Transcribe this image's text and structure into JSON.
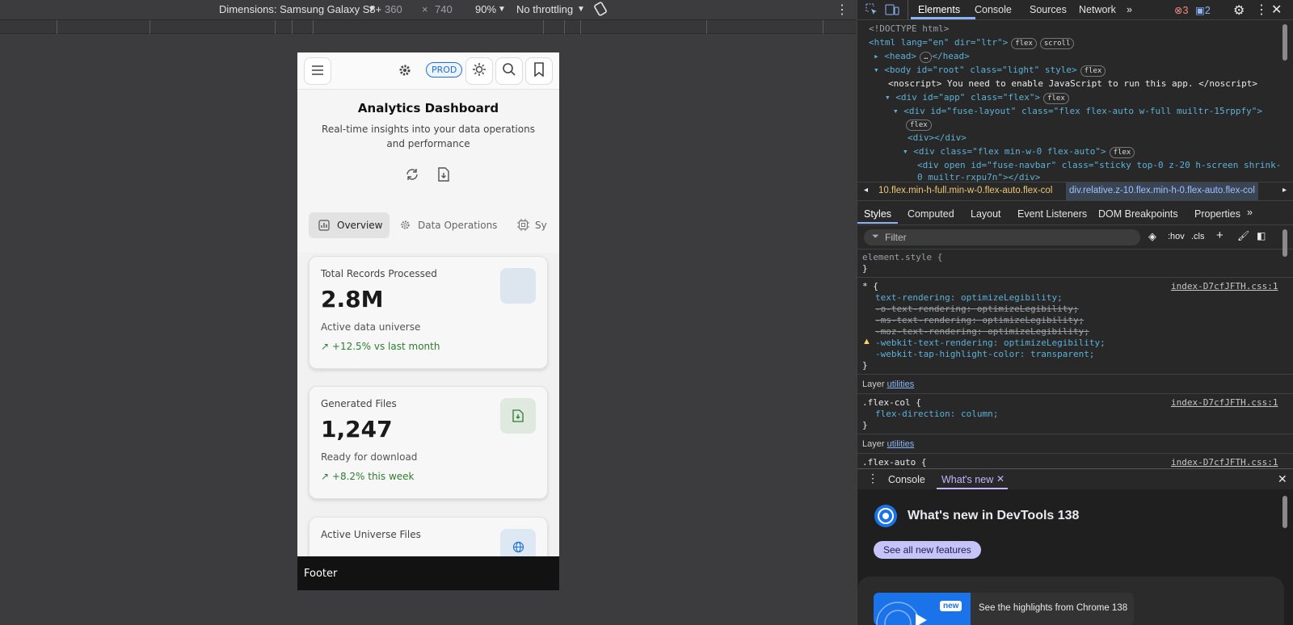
{
  "device_toolbar": {
    "dimensions_label": "Dimensions: Samsung Galaxy S8+",
    "width": "360",
    "x": "×",
    "height": "740",
    "zoom": "90%",
    "throttling": "No throttling"
  },
  "app": {
    "env_badge": "PROD",
    "title": "Analytics Dashboard",
    "subtitle": "Real-time insights into your data operations and performance",
    "tabs": [
      "Overview",
      "Data Operations",
      "Sy"
    ],
    "cards": [
      {
        "label": "Total Records Processed",
        "value": "2.8M",
        "desc": "Active data universe",
        "trend": "+12.5% vs last month"
      },
      {
        "label": "Generated Files",
        "value": "1,247",
        "desc": "Ready for download",
        "trend": "+8.2% this week"
      },
      {
        "label": "Active Universe Files",
        "value": "",
        "desc": "",
        "trend": ""
      }
    ],
    "footer": "Footer"
  },
  "devtools": {
    "tabs": [
      "Elements",
      "Console",
      "Sources",
      "Network"
    ],
    "errors": "3",
    "messages": "2",
    "dom": [
      "<!DOCTYPE html>",
      "<html lang=\"en\" dir=\"ltr\">",
      "<head>",
      "<body id=\"root\" class=\"light\" style>",
      "<noscript> You need to enable JavaScript to run this app. </noscript>",
      "<div id=\"app\" class=\"flex\">",
      "<div id=\"fuse-layout\" class=\"flex flex-auto w-full muiltr-15rppfy\">",
      "<div></div>",
      "<div class=\"flex min-w-0 flex-auto\">",
      "<div open id=\"fuse-navbar\" class=\"sticky top-0 z-20 h-screen shrink-",
      "0 muiltr-rxpu7n\"></div>"
    ],
    "breadcrumb": [
      "10.flex.min-h-full.min-w-0.flex-auto.flex-col",
      "div.relative.z-10.flex.min-h-0.flex-auto.flex-col"
    ],
    "style_tabs": [
      "Styles",
      "Computed",
      "Layout",
      "Event Listeners",
      "DOM Breakpoints",
      "Properties"
    ],
    "filter_placeholder": "Filter",
    "hov": ":hov",
    "cls": ".cls",
    "element_style": "element.style {",
    "rule_source": "index-D7cfJFTH.css:1",
    "star_rule": [
      "text-rendering: optimizeLegibility;",
      "-o-text-rendering: optimizeLegibility;",
      "-ms-text-rendering: optimizeLegibility;",
      "-moz-text-rendering: optimizeLegibility;",
      "-webkit-text-rendering: optimizeLegibility;",
      "-webkit-tap-highlight-color: transparent;"
    ],
    "layer_label": "Layer",
    "layer_name": "utilities",
    "flex_col_selector": ".flex-col {",
    "flex_col_decl": "flex-direction: column;",
    "flex_auto_selector": ".flex-auto {",
    "drawer_tabs": [
      "Console",
      "What's new"
    ],
    "whats_new_title": "What's new in DevTools 138",
    "see_all": "See all new features",
    "new_badge": "new",
    "highlights": "See the highlights from Chrome 138"
  }
}
